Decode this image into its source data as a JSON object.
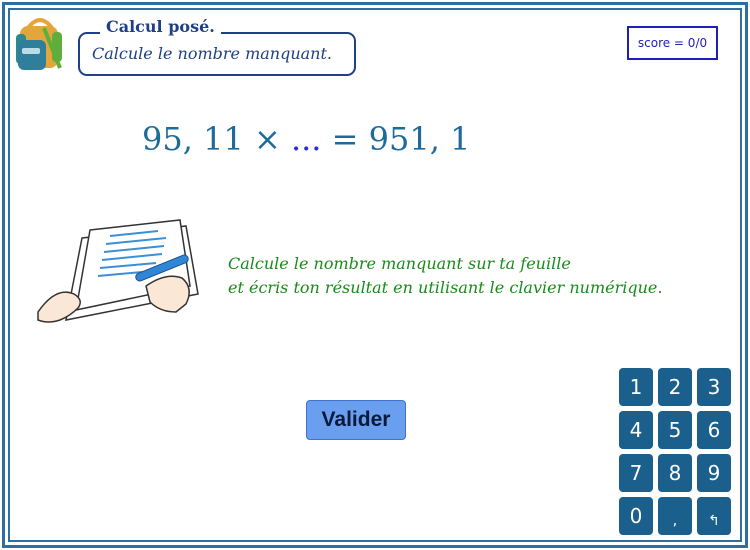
{
  "header": {
    "title": "Calcul posé.",
    "subtitle": "Calcule le nombre manquant."
  },
  "score": {
    "label": "score = 0/0"
  },
  "problem": {
    "left": "95, 11 × ",
    "blank": "...",
    "right": " = 951, 1"
  },
  "instructions": {
    "line1": "Calcule le nombre manquant sur ta feuille",
    "line2": "et écris ton résultat en utilisant le clavier numérique."
  },
  "actions": {
    "validate_label": "Valider"
  },
  "keypad": {
    "keys": [
      "1",
      "2",
      "3",
      "4",
      "5",
      "6",
      "7",
      "8",
      "9",
      "0",
      ",",
      "↰"
    ]
  },
  "colors": {
    "frame": "#2e6fa3",
    "title": "#1f3f86",
    "equation": "#1e6b9a",
    "instructions": "#1a8a1a",
    "key_bg": "#1b5f8c",
    "validate_bg": "#6a9ff0"
  },
  "icons": [
    "backpack-icon",
    "writing-hands-icon"
  ]
}
